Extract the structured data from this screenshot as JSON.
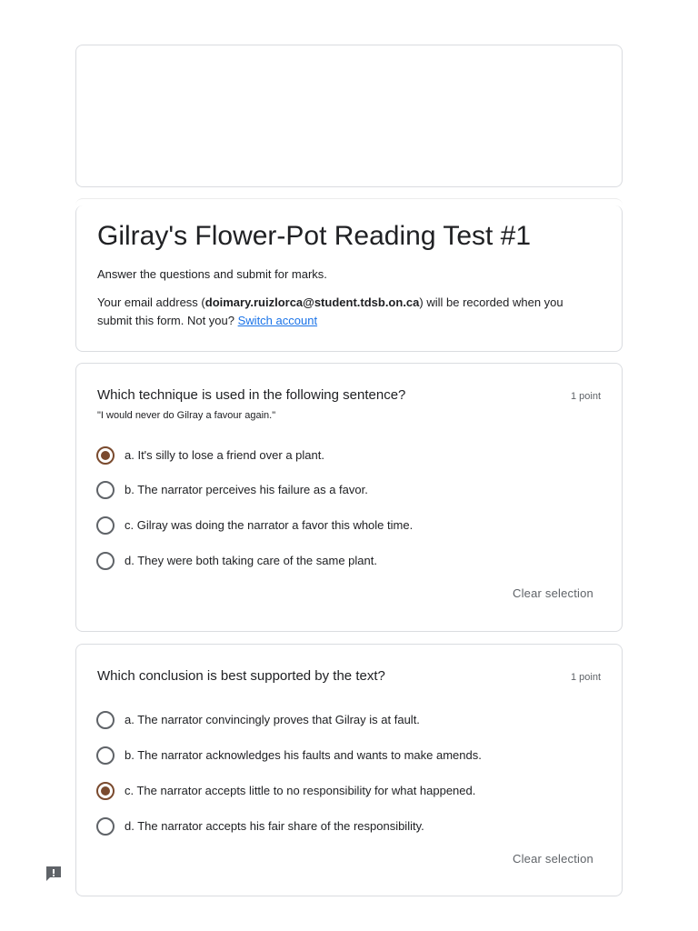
{
  "form": {
    "title": "Gilray's Flower-Pot Reading Test #1",
    "description": "Answer the questions and submit for marks.",
    "email_prefix": "Your email address (",
    "email": "doimary.ruizlorca@student.tdsb.on.ca",
    "email_suffix": ") will be recorded when you submit this form. Not you? ",
    "switch_account": "Switch account"
  },
  "questions": [
    {
      "title": "Which technique is used in the following sentence?",
      "subtitle": "\"I would never do Gilray a favour again.\"",
      "points": "1 point",
      "options": [
        {
          "label": "a. It's silly to lose a friend over a plant.",
          "checked": true
        },
        {
          "label": "b. The narrator perceives his failure as a favor.",
          "checked": false
        },
        {
          "label": "c. Gilray was doing the narrator a favor this whole time.",
          "checked": false
        },
        {
          "label": "d. They were both taking care of the same plant.",
          "checked": false
        }
      ],
      "clear_label": "Clear selection"
    },
    {
      "title": "Which conclusion is best supported by the text?",
      "points": "1 point",
      "options": [
        {
          "label": "a. The narrator convincingly proves that Gilray is at fault.",
          "checked": false
        },
        {
          "label": "b. The narrator acknowledges his faults and wants to make amends.",
          "checked": false
        },
        {
          "label": "c. The narrator accepts little to no responsibility for what happened.",
          "checked": true
        },
        {
          "label": "d. The narrator accepts his fair share of the responsibility.",
          "checked": false
        }
      ],
      "clear_label": "Clear selection"
    }
  ],
  "icons": {
    "feedback": "feedback-icon"
  },
  "colors": {
    "accent": "#7a4a2e",
    "link": "#1a73e8",
    "border": "#dadce0"
  }
}
